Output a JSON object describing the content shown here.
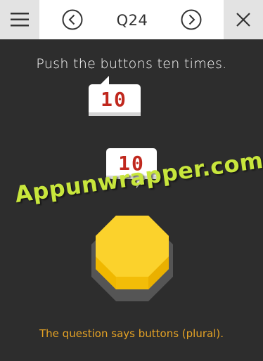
{
  "header": {
    "title": "Q24",
    "menu_icon": "menu-icon",
    "prev_icon": "chevron-left-circle-icon",
    "next_icon": "chevron-right-circle-icon",
    "close_icon": "close-icon"
  },
  "question": {
    "prompt": "Push the buttons ten times.",
    "counter_top": "10",
    "counter_bottom": "10",
    "hint": "The question says buttons (plural)."
  },
  "watermark": "Appunwrapper.com",
  "colors": {
    "background": "#2d2d2d",
    "button_yellow": "#f7c81c",
    "counter_red": "#c0281e",
    "hint_orange": "#e6a325",
    "watermark_green": "#c8e63c"
  }
}
